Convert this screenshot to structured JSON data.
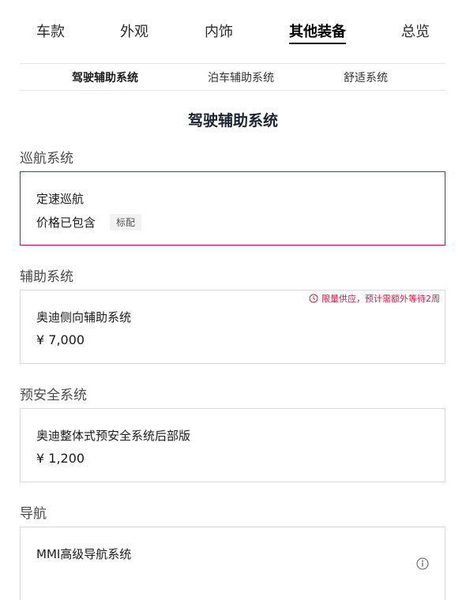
{
  "top_tabs": [
    {
      "label": "车款"
    },
    {
      "label": "外观"
    },
    {
      "label": "内饰"
    },
    {
      "label": "其他装备",
      "active": true
    },
    {
      "label": "总览"
    }
  ],
  "sub_tabs": [
    {
      "label": "驾驶辅助系统",
      "active": true
    },
    {
      "label": "泊车辅助系统"
    },
    {
      "label": "舒适系统"
    }
  ],
  "section_title": "驾驶辅助系统",
  "categories": [
    {
      "title": "巡航系统",
      "option": {
        "name": "定速巡航",
        "included_text": "价格已包含",
        "badge": "标配",
        "selected": true
      }
    },
    {
      "title": "辅助系统",
      "option": {
        "name": "奥迪侧向辅助系统",
        "price": "¥ 7,000",
        "notice": "限量供应，预计需额外等待2周"
      }
    },
    {
      "title": "预安全系统",
      "option": {
        "name": "奥迪整体式预安全系统后部版",
        "price": "¥ 1,200"
      }
    },
    {
      "title": "导航",
      "option": {
        "name": "MMI高级导航系统",
        "icon": "info-icon"
      }
    }
  ],
  "colors": {
    "accent": "#b0193c",
    "notice": "#c1224a",
    "border": "#d9d9d9"
  }
}
